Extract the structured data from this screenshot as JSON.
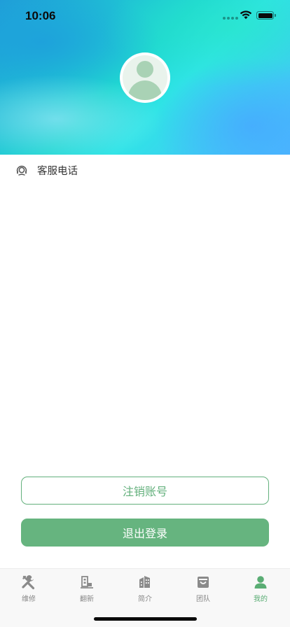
{
  "status_bar": {
    "time": "10:06"
  },
  "profile": {
    "avatar_icon": "user-avatar-icon"
  },
  "menu": {
    "customer_service_label": "客服电话",
    "customer_service_icon": "headset-icon"
  },
  "buttons": {
    "cancel_account_label": "注销账号",
    "logout_label": "退出登录"
  },
  "tabbar": {
    "items": [
      {
        "label": "维修",
        "icon": "tools-icon",
        "active": false
      },
      {
        "label": "翻新",
        "icon": "renovate-icon",
        "active": false
      },
      {
        "label": "简介",
        "icon": "building-icon",
        "active": false
      },
      {
        "label": "团队",
        "icon": "team-box-icon",
        "active": false
      },
      {
        "label": "我的",
        "icon": "person-icon",
        "active": true
      }
    ]
  },
  "colors": {
    "accent": "#66b47f",
    "accent_border": "#63b07c",
    "tab_inactive": "#888888"
  }
}
